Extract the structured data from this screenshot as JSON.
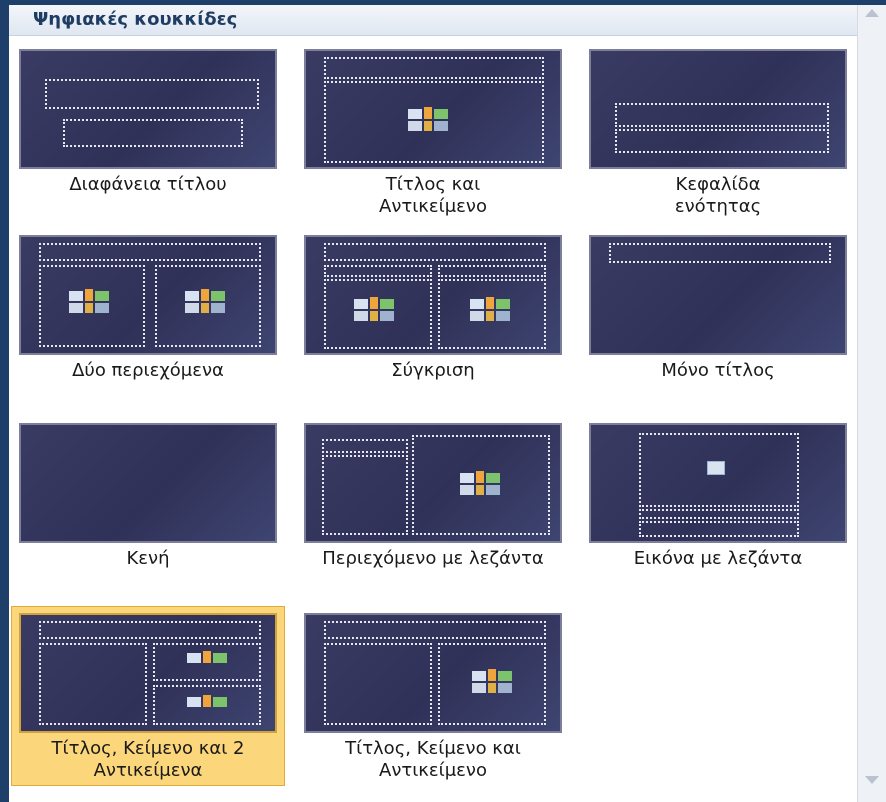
{
  "window": {
    "frame_color": "#1d3f6a"
  },
  "header": {
    "title": "Ψηφιακές κουκκίδες"
  },
  "layouts": [
    {
      "label": "Διαφάνεια τίτλου",
      "selected": false
    },
    {
      "label": "Τίτλος και Αντικείμενο",
      "selected": false
    },
    {
      "label": "Κεφαλίδα ενότητας",
      "selected": false
    },
    {
      "label": "Δύο περιεχόμενα",
      "selected": false
    },
    {
      "label": "Σύγκριση",
      "selected": false
    },
    {
      "label": "Μόνο τίτλος",
      "selected": false
    },
    {
      "label": "Κενή",
      "selected": false
    },
    {
      "label": "Περιεχόμενο με λεζάντα",
      "selected": false
    },
    {
      "label": "Εικόνα με λεζάντα",
      "selected": false
    },
    {
      "label": "Τίτλος, Κείμενο και 2 Αντικείμενα",
      "selected": true
    },
    {
      "label": "Τίτλος, Κείμενο και Αντικείμενο",
      "selected": false
    }
  ],
  "colors": {
    "thumbnail": "#333459",
    "selected_bg": "#fbd67a",
    "header_text": "#1f3c63"
  },
  "icons": [
    "content-icon"
  ]
}
